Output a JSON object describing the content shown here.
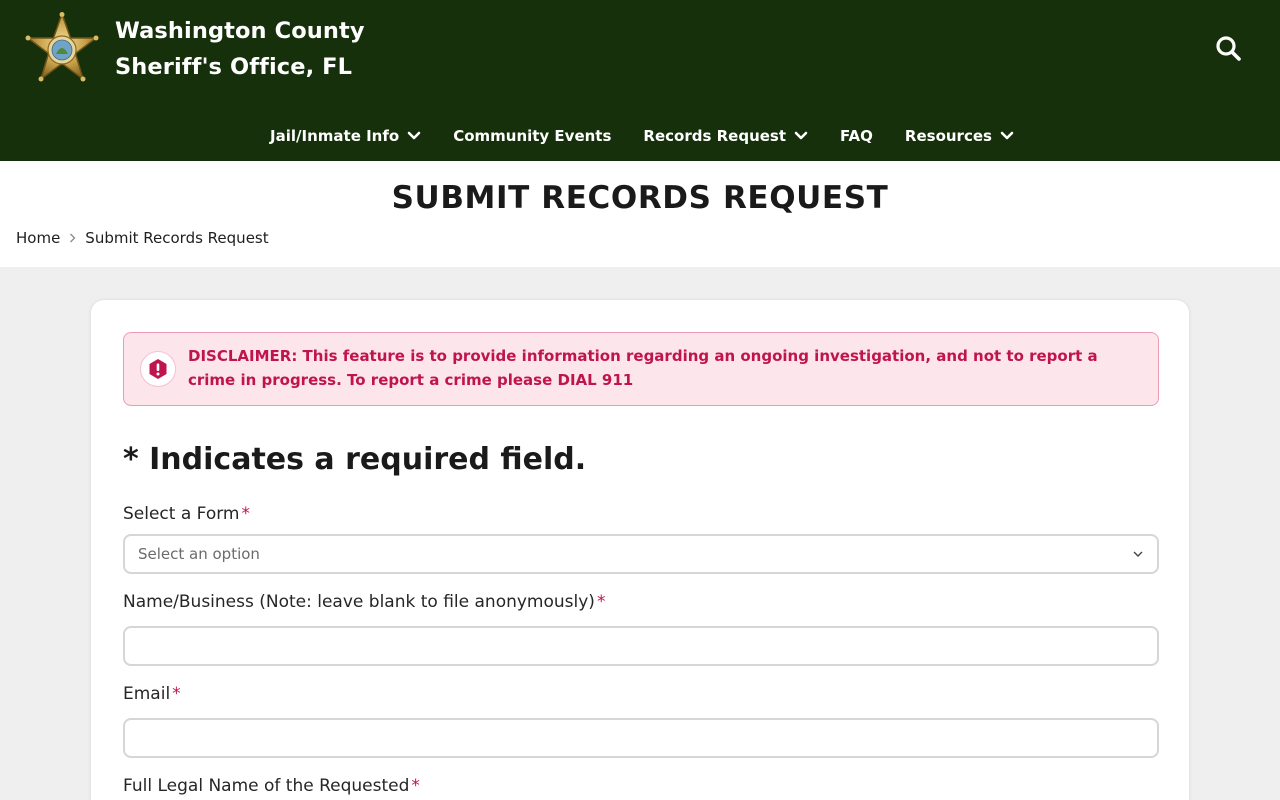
{
  "header": {
    "title_line1": "Washington County",
    "title_line2": "Sheriff's Office, FL",
    "logo_icon": "sheriff-star-badge-icon",
    "search_icon": "search-icon"
  },
  "nav": {
    "items": [
      {
        "label": "Jail/Inmate Info",
        "has_dropdown": true
      },
      {
        "label": "Community Events",
        "has_dropdown": false
      },
      {
        "label": "Records Request",
        "has_dropdown": true
      },
      {
        "label": "FAQ",
        "has_dropdown": false
      },
      {
        "label": "Resources",
        "has_dropdown": true
      }
    ]
  },
  "page": {
    "title": "SUBMIT RECORDS REQUEST",
    "breadcrumb": {
      "home": "Home",
      "current": "Submit Records Request"
    }
  },
  "alert": {
    "text": "DISCLAIMER: This feature is to provide information regarding an ongoing investigation, and not to report a crime in progress. To report a crime please DIAL 911",
    "icon": "exclamation-hexagon-icon"
  },
  "form": {
    "required_note": "* Indicates a required field.",
    "required_marker": "*",
    "select_form": {
      "label": "Select a Form",
      "placeholder": "Select an option"
    },
    "name_business": {
      "label": "Name/Business (Note: leave blank to file anonymously)",
      "value": ""
    },
    "email": {
      "label": "Email",
      "value": ""
    },
    "full_legal_name": {
      "label": "Full Legal Name of the Requested"
    }
  },
  "colors": {
    "header_bg": "#15300a",
    "accent_pink": "#c0144f",
    "alert_bg": "#fde5ec",
    "page_bg": "#efefef"
  }
}
